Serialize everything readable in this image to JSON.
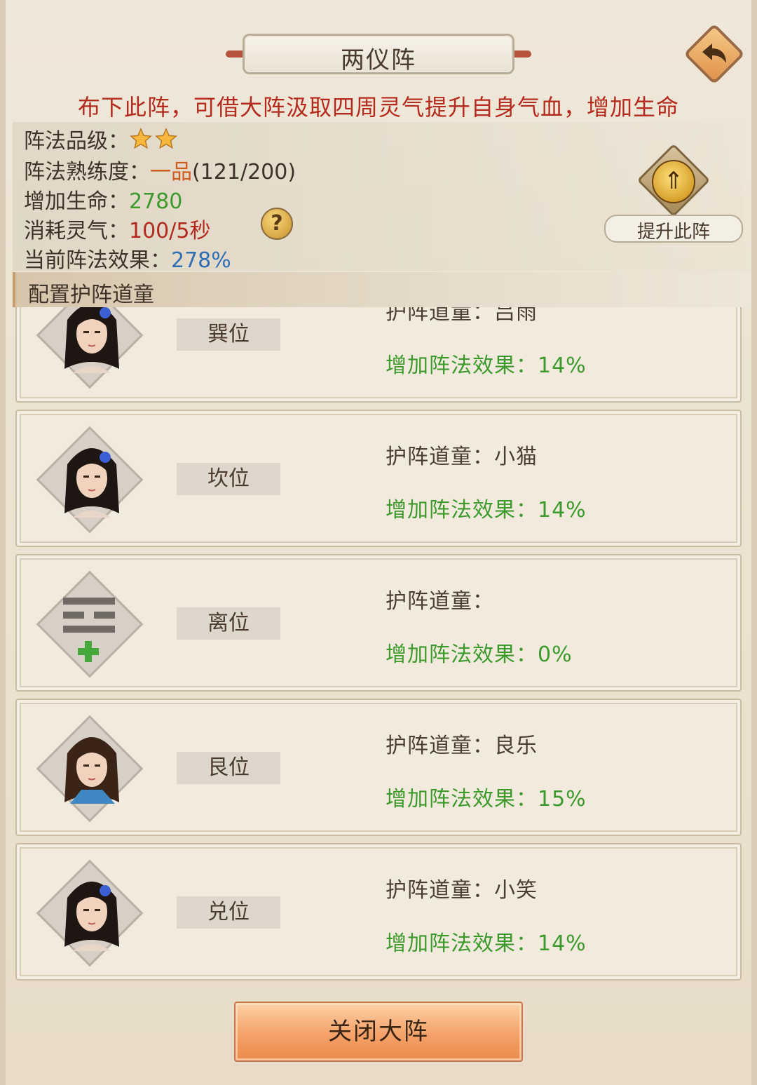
{
  "title": "两仪阵",
  "description": "布下此阵，可借大阵汲取四周灵气提升自身气血，增加生命",
  "info": {
    "grade_label": "阵法品级：",
    "grade_stars": 2,
    "proficiency_label": "阵法熟练度：",
    "proficiency_rank": "一品",
    "proficiency_value": "(121/200)",
    "life_label": "增加生命：",
    "life_value": "2780",
    "consume_label": "消耗灵气：",
    "consume_value": "100/5秒",
    "effect_label": "当前阵法效果：",
    "effect_value": "278%"
  },
  "upgrade_label": "提升此阵",
  "section_title": "配置护阵道童",
  "slots": [
    {
      "position": "巽位",
      "guard": "护阵道童：吕雨",
      "effect": "增加阵法效果：14%",
      "avatar": "female-portrait-icon"
    },
    {
      "position": "坎位",
      "guard": "护阵道童：小猫",
      "effect": "增加阵法效果：14%",
      "avatar": "female-portrait-icon"
    },
    {
      "position": "离位",
      "guard": "护阵道童：",
      "effect": "增加阵法效果：0%",
      "avatar": "li-trigram-add-icon"
    },
    {
      "position": "艮位",
      "guard": "护阵道童：良乐",
      "effect": "增加阵法效果：15%",
      "avatar": "male-portrait-icon"
    },
    {
      "position": "兑位",
      "guard": "护阵道童：小笑",
      "effect": "增加阵法效果：14%",
      "avatar": "female-portrait-icon"
    }
  ],
  "close_button": "关闭大阵",
  "colors": {
    "description": "#b42a1d",
    "rank": "#d05a1c",
    "life": "#3c9a2c",
    "consume": "#b22a1e",
    "effect": "#2f6fb5",
    "slot_effect": "#3c9a2c"
  }
}
